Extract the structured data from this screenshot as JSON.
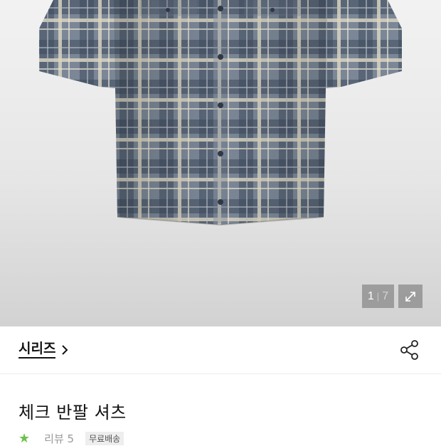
{
  "gallery": {
    "current_index": "1",
    "total": "7",
    "separator": "|",
    "expand_icon": "expand-icon"
  },
  "series": {
    "label": "시리즈",
    "chevron_icon": "chevron-right-icon",
    "share_icon": "share-icon"
  },
  "product": {
    "title": "체크 반팔 셔츠"
  },
  "rating_row": {
    "star_icon": "star-icon",
    "rating": "",
    "reviews": "리뷰 5",
    "badge": "무료배송"
  },
  "colors": {
    "star": "#6cc24a",
    "shirt_base": "#7b8797",
    "shirt_dark": "#3d4a5c",
    "shirt_light": "#d9d4c0"
  }
}
